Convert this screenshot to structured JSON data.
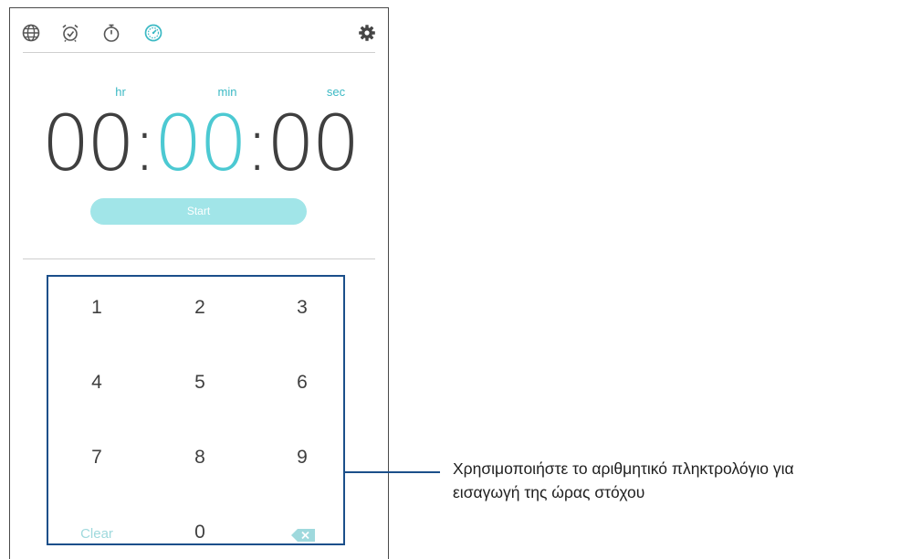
{
  "tabs": [
    {
      "icon": "globe-icon"
    },
    {
      "icon": "alarm-clock-icon"
    },
    {
      "icon": "stopwatch-icon"
    },
    {
      "icon": "timer-icon",
      "active": true
    }
  ],
  "settings_icon": "gear-icon",
  "timer": {
    "hours": "00",
    "minutes": "00",
    "seconds": "00",
    "separator": ":",
    "hr_label": "hr",
    "min_label": "min",
    "sec_label": "sec"
  },
  "start_label": "Start",
  "keypad": {
    "keys": [
      "1",
      "2",
      "3",
      "4",
      "5",
      "6",
      "7",
      "8",
      "9"
    ],
    "clear_label": "Clear",
    "zero": "0",
    "backspace_icon": "backspace-icon"
  },
  "callout": {
    "line1": "Χρησιμοποιήστε το αριθμητικό πληκτρολόγιο για",
    "line2": "εισαγωγή της ώρας στόχου"
  },
  "colors": {
    "accent": "#4cc9d2",
    "start_button": "#a1e5e8",
    "annotation": "#1b4f8a",
    "digits": "#3f3f3f"
  }
}
